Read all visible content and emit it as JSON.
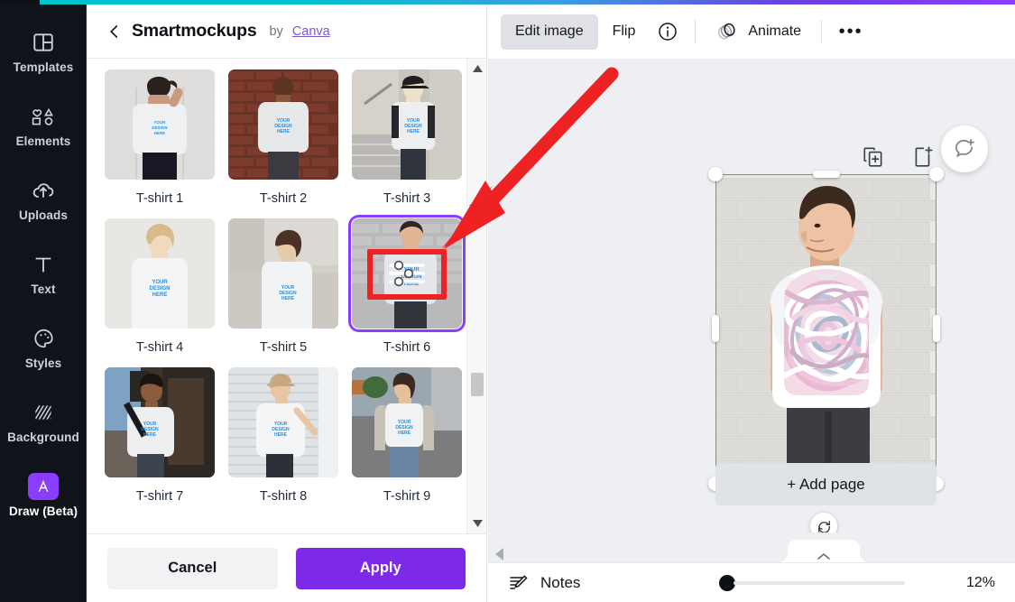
{
  "app": {
    "accent_purple": "#7d2ae8",
    "accent_teal": "#00c4cc",
    "annotation_red": "#ee2222"
  },
  "sidebar": {
    "items": [
      {
        "label": "Templates",
        "icon": "templates-icon",
        "active": false
      },
      {
        "label": "Elements",
        "icon": "elements-icon",
        "active": false
      },
      {
        "label": "Uploads",
        "icon": "uploads-icon",
        "active": false
      },
      {
        "label": "Text",
        "icon": "text-icon",
        "active": false
      },
      {
        "label": "Styles",
        "icon": "styles-icon",
        "active": false
      },
      {
        "label": "Background",
        "icon": "background-icon",
        "active": false
      },
      {
        "label": "Draw (Beta)",
        "icon": "draw-icon",
        "active": true
      }
    ]
  },
  "panel": {
    "back_icon": "back-chevron-icon",
    "title": "Smartmockups",
    "by_text": "by",
    "brand_link": "Canva",
    "items": [
      {
        "label": "T-shirt 1",
        "selected": false
      },
      {
        "label": "T-shirt 2",
        "selected": false
      },
      {
        "label": "T-shirt 3",
        "selected": false
      },
      {
        "label": "T-shirt 4",
        "selected": false
      },
      {
        "label": "T-shirt 5",
        "selected": false
      },
      {
        "label": "T-shirt 6",
        "selected": true
      },
      {
        "label": "T-shirt 7",
        "selected": false
      },
      {
        "label": "T-shirt 8",
        "selected": false
      },
      {
        "label": "T-shirt 9",
        "selected": false
      }
    ],
    "design_placeholder_line1": "YOUR",
    "design_placeholder_line2": "DESIGN",
    "design_placeholder_line3": "HERE",
    "cancel_label": "Cancel",
    "apply_label": "Apply"
  },
  "toolbar": {
    "edit_image_label": "Edit image",
    "flip_label": "Flip",
    "info_icon": "info-icon",
    "animate_icon": "animate-icon",
    "animate_label": "Animate",
    "more_label": "•••"
  },
  "canvas": {
    "duplicate_page_icon": "duplicate-page-icon",
    "add_page_icon": "add-page-icon",
    "comment_icon": "add-comment-icon",
    "rotate_icon": "rotate-handle-icon",
    "add_page_label": "+ Add page"
  },
  "bottom_bar": {
    "collapse_icon": "collapse-panel-icon",
    "expand_tab_icon": "chevron-up-icon",
    "notes_icon": "notes-pencil-icon",
    "notes_label": "Notes",
    "zoom_percent": "12%",
    "zoom_value": 12
  }
}
